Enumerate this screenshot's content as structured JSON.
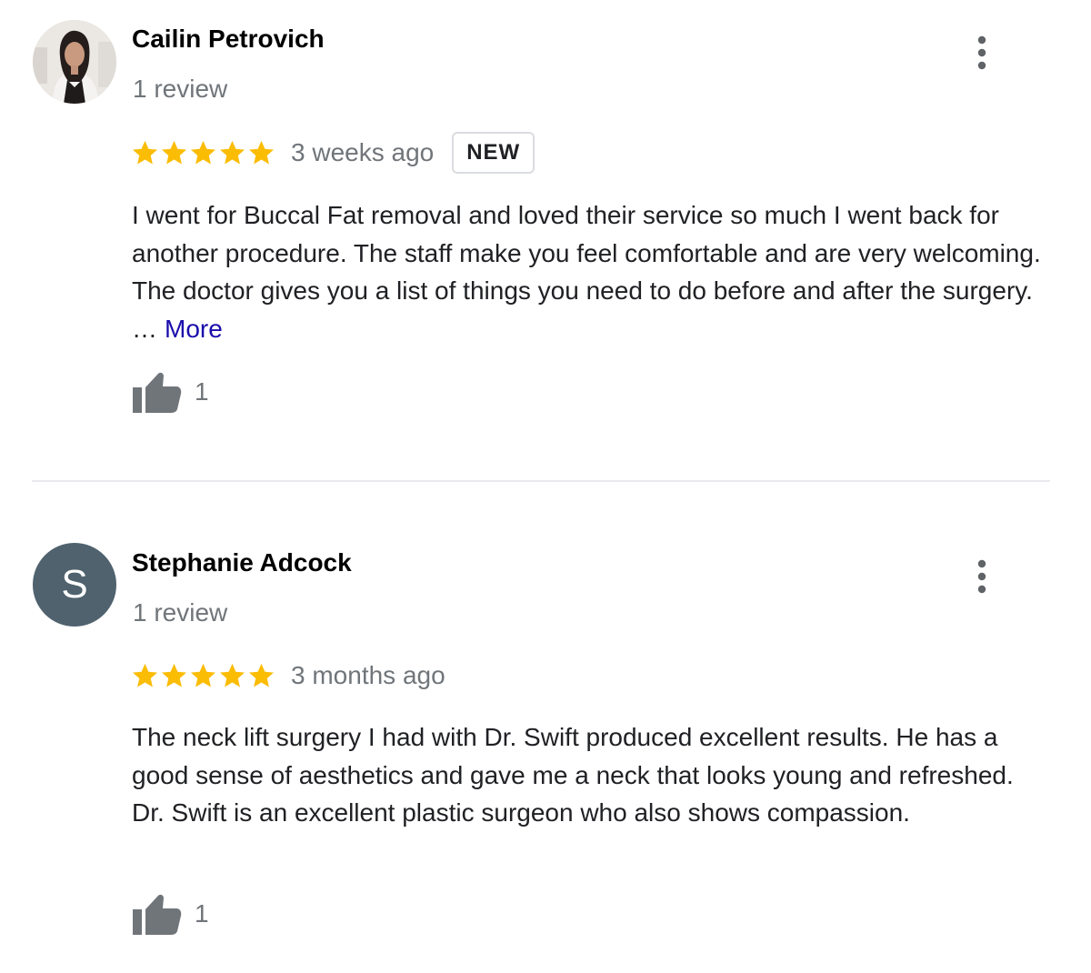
{
  "colors": {
    "star": "#fbbc04",
    "muted_text": "#70757a",
    "link": "#1a0dab",
    "avatar_letter_bg": "#4f626e",
    "like_icon": "#70757a"
  },
  "reviews": [
    {
      "author": "Cailin Petrovich",
      "author_meta": "1 review",
      "rating": 5,
      "date": "3 weeks ago",
      "badge": "NEW",
      "text": "I went for Buccal Fat removal and loved their service so much I went back for another procedure. The staff make you feel comfortable and are very welcoming. The doctor gives you a list of things you need to do before and after the surgery.",
      "ellipsis": "…",
      "more_label": "More",
      "likes": "1",
      "avatar_type": "photo"
    },
    {
      "author": "Stephanie Adcock",
      "author_meta": "1 review",
      "rating": 5,
      "date": "3 months ago",
      "text": "The neck lift surgery I had with Dr. Swift produced excellent results. He has a good sense of aesthetics and gave me a neck that looks young and refreshed. Dr. Swift is an excellent plastic surgeon who also shows compassion.",
      "likes": "1",
      "avatar_type": "letter",
      "avatar_letter": "S"
    }
  ]
}
